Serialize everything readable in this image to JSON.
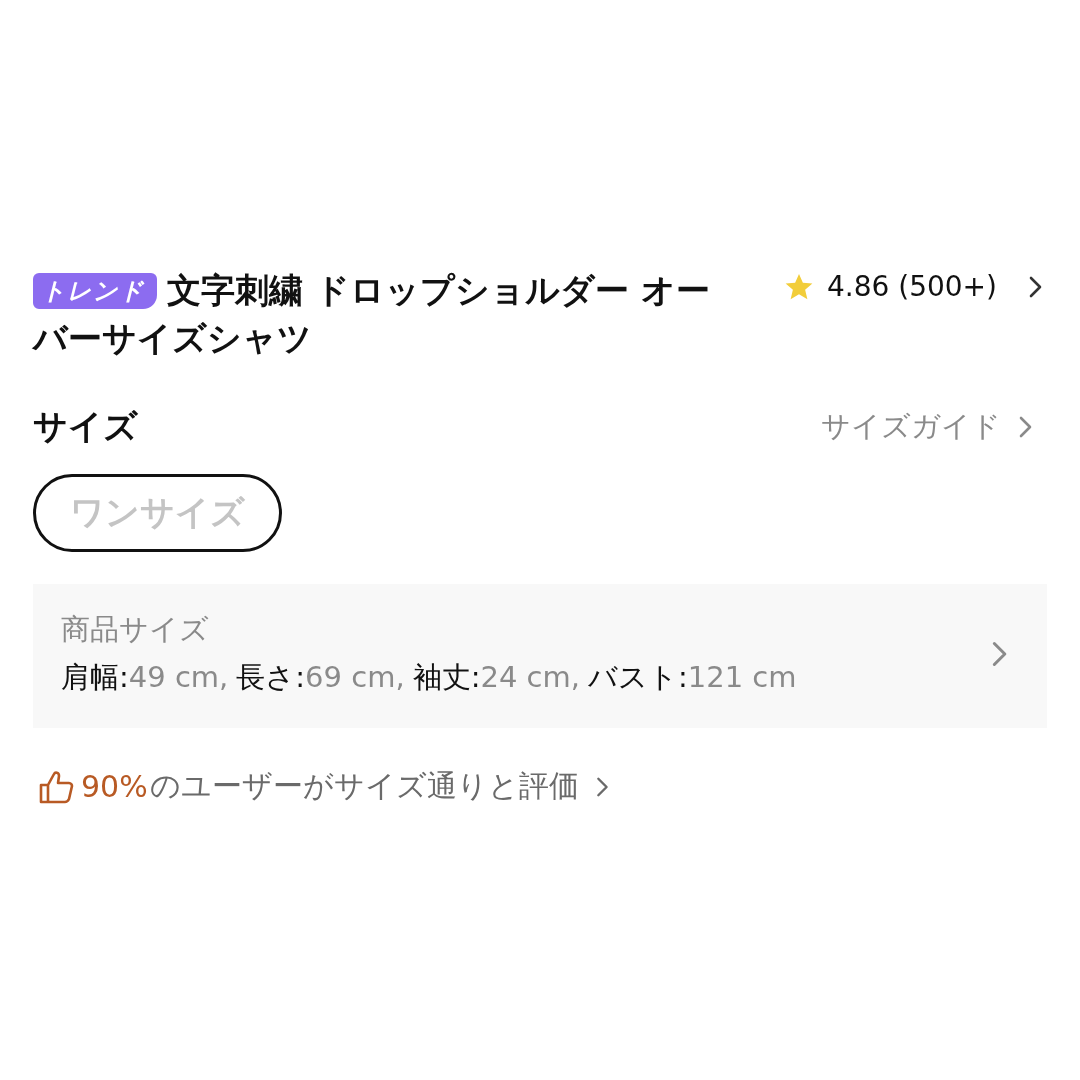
{
  "product": {
    "badge": "トレンド",
    "title": "文字刺繍 ドロップショルダー オーバーサイズシャツ",
    "rating": {
      "score": "4.86",
      "count": "(500+)"
    }
  },
  "size_section": {
    "heading": "サイズ",
    "guide_link": "サイズガイド",
    "options": [
      {
        "label": "ワンサイズ",
        "selected": true,
        "disabled": true
      }
    ]
  },
  "size_panel": {
    "title": "商品サイズ",
    "measurements": [
      {
        "label": "肩幅:",
        "value": "49 cm,"
      },
      {
        "label": "長さ:",
        "value": "69 cm,"
      },
      {
        "label": "袖丈:",
        "value": "24 cm,"
      },
      {
        "label": "バスト:",
        "value": "121 cm"
      }
    ]
  },
  "fit_rating": {
    "percent": "90%",
    "text": "のユーザーがサイズ通りと評価"
  }
}
